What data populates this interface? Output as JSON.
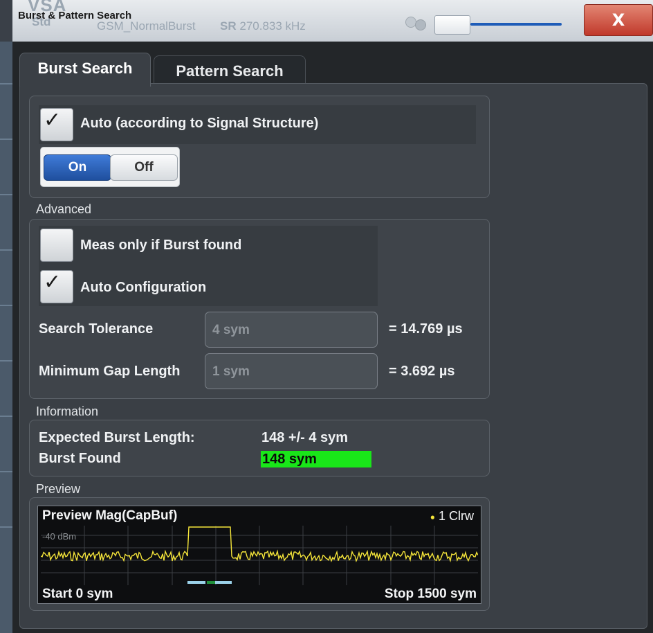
{
  "background": {
    "app_name": "VSA",
    "std_label": "Std",
    "std_value": "GSM_NormalBurst",
    "sr_label": "SR",
    "sr_value": "270.833 kHz"
  },
  "window": {
    "title": "Burst & Pattern Search",
    "close_label": "X"
  },
  "tabs": [
    {
      "label": "Burst Search",
      "active": true
    },
    {
      "label": "Pattern Search",
      "active": false
    }
  ],
  "auto": {
    "label": "Auto (according to Signal Structure)",
    "checked": true,
    "on_label": "On",
    "off_label": "Off",
    "state": "On"
  },
  "advanced": {
    "group_label": "Advanced",
    "meas_only_label": "Meas only if Burst found",
    "meas_only_checked": false,
    "auto_config_label": "Auto Configuration",
    "auto_config_checked": true,
    "search_tolerance_label": "Search Tolerance",
    "search_tolerance_value": "4 sym",
    "search_tolerance_time": "= 14.769 µs",
    "min_gap_label": "Minimum Gap Length",
    "min_gap_value": "1 sym",
    "min_gap_time": "= 3.692 µs"
  },
  "information": {
    "group_label": "Information",
    "expected_label": "Expected Burst Length:",
    "expected_value": "148 +/- 4 sym",
    "found_label": "Burst Found",
    "found_value": "148 sym"
  },
  "preview": {
    "group_label": "Preview",
    "title": "Preview Mag(CapBuf)",
    "trace_label": "1 Clrw",
    "ref_level": "-40 dBm",
    "start_label": "Start 0 sym",
    "stop_label": "Stop 1500 sym"
  },
  "colors": {
    "accent_on": "#1f4f9e",
    "found_green": "#19e619",
    "trace_yellow": "#f5e53a",
    "close_red": "#c0392b"
  }
}
